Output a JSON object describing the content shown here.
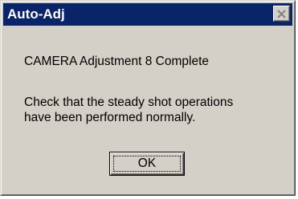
{
  "window": {
    "title": "Auto-Adj"
  },
  "message": {
    "line1": "CAMERA Adjustment 8 Complete",
    "line2": "Check that the steady shot operations",
    "line3": "have been performed normally."
  },
  "buttons": {
    "ok_label": "OK"
  },
  "icons": {
    "close": "close-icon"
  },
  "colors": {
    "titlebar": "#0a246a",
    "face": "#d4d0c8"
  }
}
